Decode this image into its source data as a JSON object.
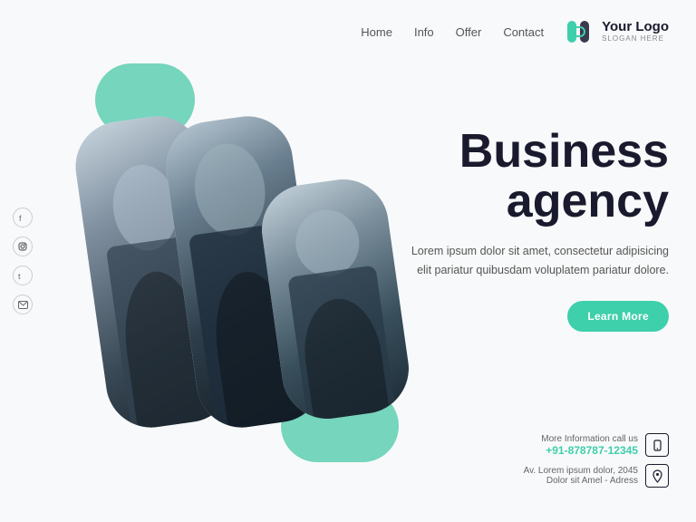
{
  "header": {
    "nav": {
      "home": "Home",
      "info": "Info",
      "offer": "Offer",
      "contact": "Contact"
    },
    "logo": {
      "name": "Your Logo",
      "slogan": "SLOGAN HERE"
    }
  },
  "social": {
    "items": [
      {
        "name": "facebook",
        "icon": "f"
      },
      {
        "name": "instagram",
        "icon": "◎"
      },
      {
        "name": "twitter",
        "icon": "t"
      },
      {
        "name": "email",
        "icon": "✉"
      }
    ]
  },
  "hero": {
    "title_line1": "Business",
    "title_line2": "agency",
    "description": "Lorem ipsum dolor sit amet, consectetur adipisicing elit pariatur quibusdam voluplatem pariatur dolore.",
    "cta_button": "Learn More"
  },
  "contact": {
    "phone_label": "More Information call us",
    "phone_value": "+91-878787-12345",
    "address_label": "Av. Lorem ipsum dolor, 2045",
    "address_value": "Dolor sit Amel - Adress"
  },
  "colors": {
    "teal": "#3ecfab",
    "dark": "#1a1a2e",
    "light_teal": "#5ecfb1"
  }
}
